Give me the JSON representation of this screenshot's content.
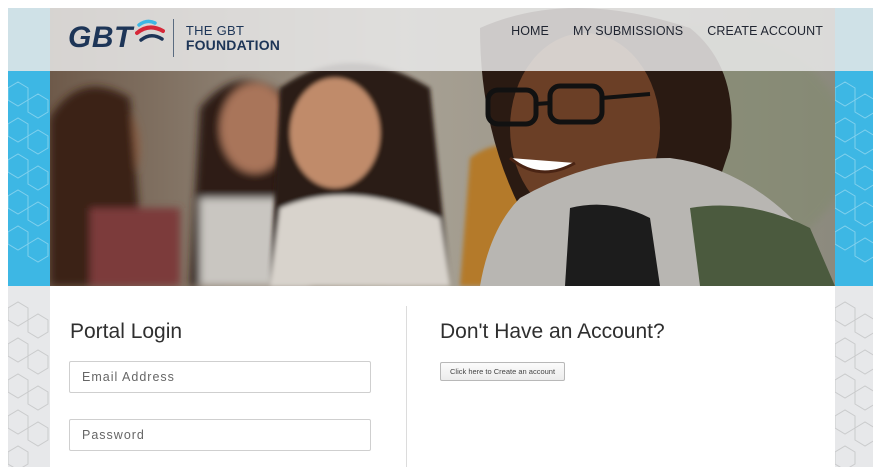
{
  "brand": {
    "logo_mark": "GBT",
    "name_line1": "THE GBT",
    "name_line2": "FOUNDATION",
    "colors": {
      "navy": "#1d3557",
      "accent_blue": "#3db7e4",
      "accent_red": "#d62839"
    }
  },
  "nav": {
    "items": [
      {
        "label": "HOME"
      },
      {
        "label": "MY SUBMISSIONS"
      },
      {
        "label": "CREATE ACCOUNT"
      }
    ]
  },
  "login": {
    "title": "Portal Login",
    "email_placeholder": "Email Address",
    "password_placeholder": "Password"
  },
  "signup": {
    "title": "Don't Have an Account?",
    "button_label": "Click here to Create an account"
  },
  "icons": [
    "gbt-logo-mark-icon",
    "hex-pattern"
  ]
}
